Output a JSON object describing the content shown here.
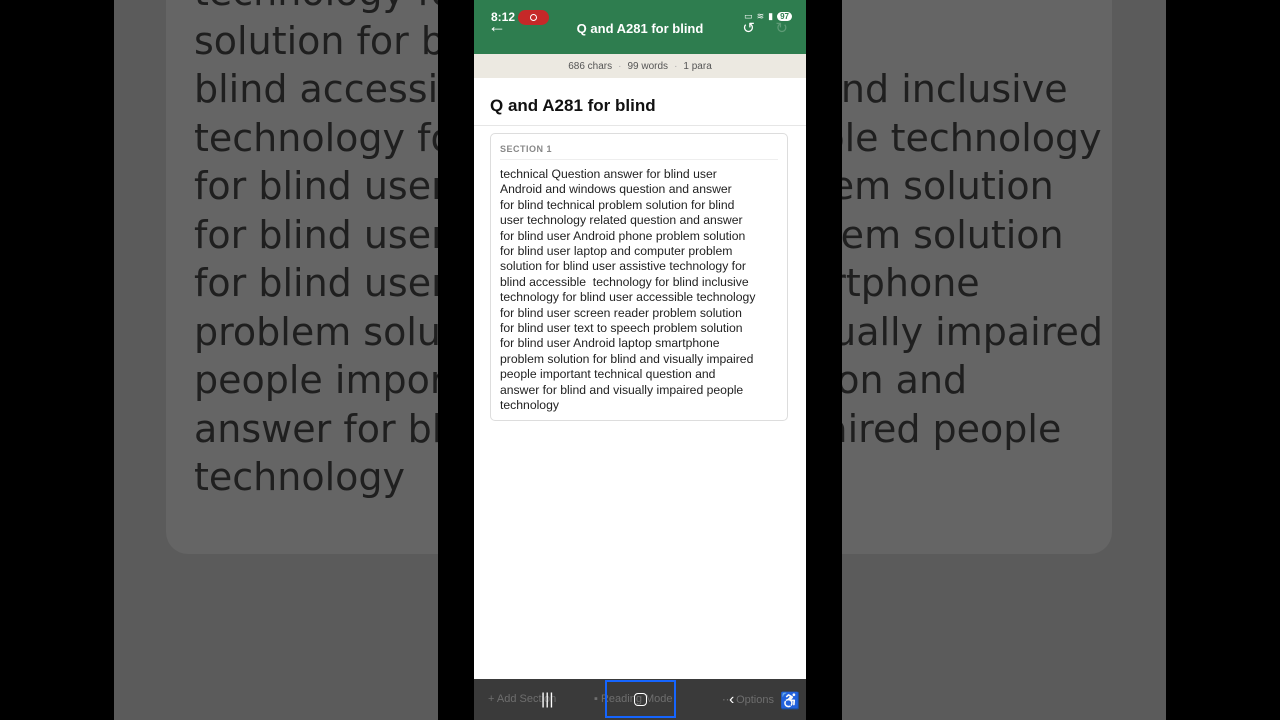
{
  "background": {
    "lines": "technology for blind user problem\nsolution for blind technology for\nblind accessible technology for blind inclusive\ntechnology for blind user accessible technology\nfor blind user screen reader problem solution\nfor blind user text to speech problem solution\nfor blind user Android laptop smartphone\nproblem solution for blind and visually impaired\npeople important technical question and\nanswer for blind and visually impaired people\ntechnology"
  },
  "status": {
    "time": "8:12",
    "battery": "97"
  },
  "appbar": {
    "title": "Q and A281 for blind",
    "back_icon": "arrow-left-icon",
    "undo_icon": "undo-icon",
    "redo_icon": "redo-icon"
  },
  "stats": {
    "chars": "686 chars",
    "words": "99 words",
    "paras": "1 para"
  },
  "document": {
    "title": "Q and A281 for blind",
    "sections": [
      {
        "label": "SECTION 1",
        "text": "technical Question answer for blind user\nAndroid and windows question and answer\nfor blind technical problem solution for blind\nuser technology related question and answer\nfor blind user Android phone problem solution\nfor blind user laptop and computer problem\nsolution for blind user assistive technology for\nblind accessible  technology for blind inclusive\ntechnology for blind user accessible technology\nfor blind user screen reader problem solution\nfor blind user text to speech problem solution\nfor blind user Android laptop smartphone\nproblem solution for blind and visually impaired\npeople important technical question and\nanswer for blind and visually impaired people\ntechnology"
      }
    ]
  },
  "bottombar": {
    "add_section": "Add Section",
    "reading_mode": "Reading Mode",
    "options": "Options"
  },
  "colors": {
    "appbar": "#2e7d4f",
    "statsbar": "#ece9e1",
    "highlight": "#1565ff"
  }
}
